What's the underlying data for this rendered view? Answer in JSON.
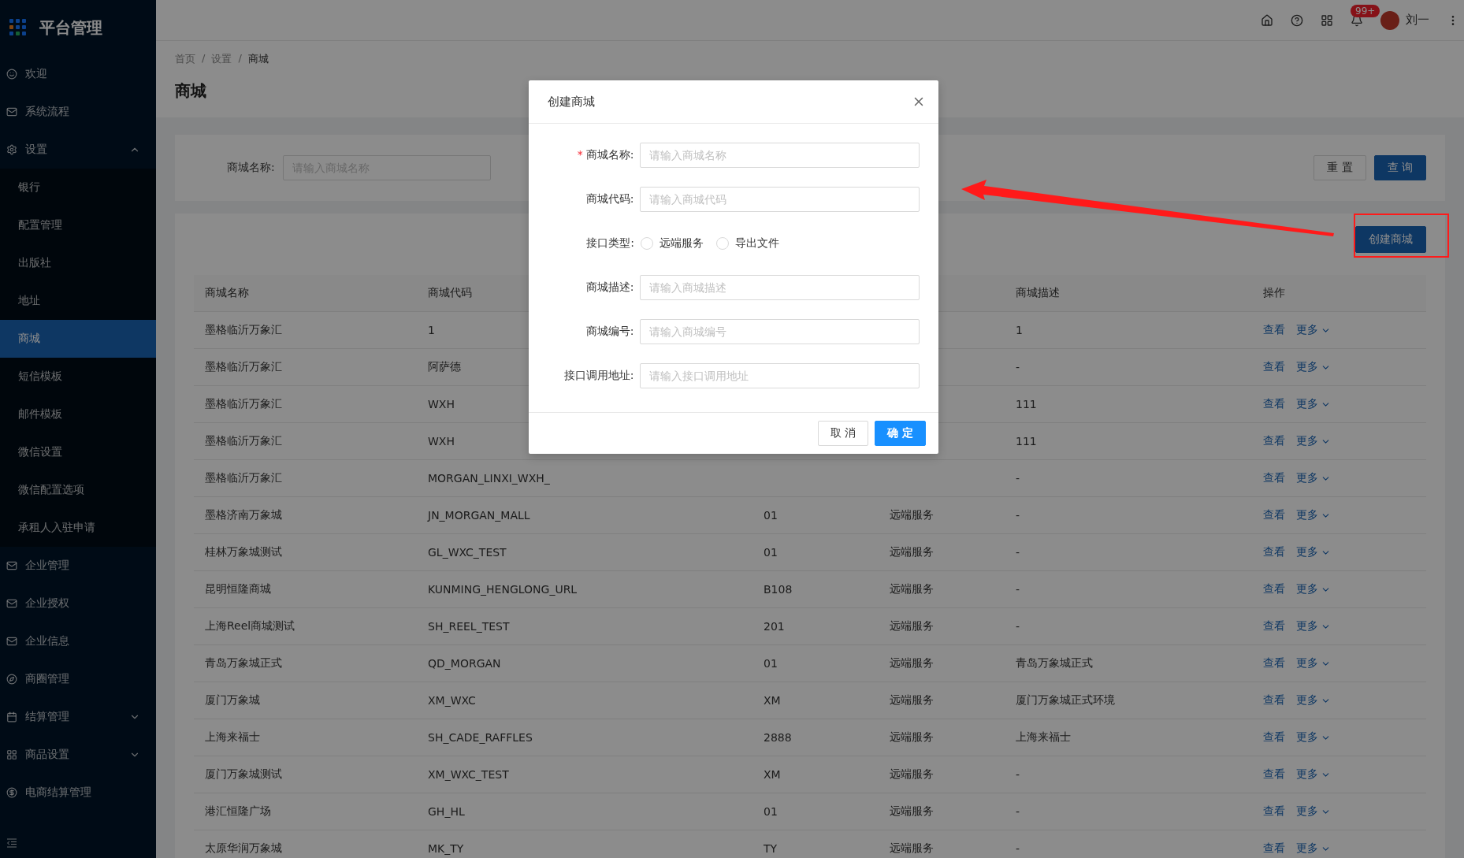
{
  "sidebar": {
    "logo": "平台管理",
    "items": [
      {
        "label": "欢迎",
        "selected": false
      },
      {
        "label": "系统流程",
        "selected": false
      },
      {
        "label": "设置",
        "selected": false,
        "expanded": true,
        "children": [
          {
            "label": "银行",
            "selected": false
          },
          {
            "label": "配置管理",
            "selected": false
          },
          {
            "label": "出版社",
            "selected": false
          },
          {
            "label": "地址",
            "selected": false
          },
          {
            "label": "商城",
            "selected": true
          },
          {
            "label": "短信模板",
            "selected": false
          },
          {
            "label": "邮件模板",
            "selected": false
          },
          {
            "label": "微信设置",
            "selected": false
          },
          {
            "label": "微信配置选项",
            "selected": false
          },
          {
            "label": "承租人入驻申请",
            "selected": false
          }
        ]
      },
      {
        "label": "企业管理",
        "selected": false
      },
      {
        "label": "企业授权",
        "selected": false
      },
      {
        "label": "企业信息",
        "selected": false
      },
      {
        "label": "商圈管理",
        "selected": false
      },
      {
        "label": "结算管理",
        "selected": false,
        "expanded": false
      },
      {
        "label": "商品设置",
        "selected": false,
        "expanded": false
      },
      {
        "label": "电商结算管理",
        "selected": false
      }
    ]
  },
  "header": {
    "badge": "99+",
    "user": "刘一"
  },
  "breadcrumb": {
    "separator": "/",
    "items": [
      "首页",
      "设置",
      "商城"
    ]
  },
  "page_title": "商城",
  "search": {
    "label": "商城名称:",
    "placeholder": "请输入商城名称",
    "buttons": [
      "重 置",
      "查 询"
    ]
  },
  "create_button": "创建商城",
  "table": {
    "columns": [
      "商城名称",
      "商城代码",
      null,
      null,
      "商城描述",
      "操作"
    ],
    "rows": [
      {
        "cells": [
          "墨格临沂万象汇",
          "1",
          null,
          null,
          "1"
        ],
        "actions": [
          "查看",
          "更多"
        ]
      },
      {
        "cells": [
          "墨格临沂万象汇",
          "阿萨德",
          null,
          null,
          "-"
        ],
        "actions": [
          "查看",
          "更多"
        ]
      },
      {
        "cells": [
          "墨格临沂万象汇",
          "WXH",
          null,
          null,
          "111"
        ],
        "actions": [
          "查看",
          "更多"
        ]
      },
      {
        "cells": [
          "墨格临沂万象汇",
          "WXH",
          null,
          null,
          "111"
        ],
        "actions": [
          "查看",
          "更多"
        ]
      },
      {
        "cells": [
          "墨格临沂万象汇",
          "MORGAN_LINXI_WXH_",
          null,
          null,
          "-"
        ],
        "actions": [
          "查看",
          "更多"
        ]
      },
      {
        "cells": [
          "墨格济南万象城",
          "JN_MORGAN_MALL",
          "01",
          "远端服务",
          "-"
        ],
        "actions": [
          "查看",
          "更多"
        ]
      },
      {
        "cells": [
          "桂林万象城测试",
          "GL_WXC_TEST",
          "01",
          "远端服务",
          "-"
        ],
        "actions": [
          "查看",
          "更多"
        ]
      },
      {
        "cells": [
          "昆明恒隆商城",
          "KUNMING_HENGLONG_URL",
          "B108",
          "远端服务",
          "-"
        ],
        "actions": [
          "查看",
          "更多"
        ]
      },
      {
        "cells": [
          "上海Reel商城测试",
          "SH_REEL_TEST",
          "201",
          "远端服务",
          "-"
        ],
        "actions": [
          "查看",
          "更多"
        ]
      },
      {
        "cells": [
          "青岛万象城正式",
          "QD_MORGAN",
          "01",
          "远端服务",
          "青岛万象城正式"
        ],
        "actions": [
          "查看",
          "更多"
        ]
      },
      {
        "cells": [
          "厦门万象城",
          "XM_WXC",
          "XM",
          "远端服务",
          "厦门万象城正式环境"
        ],
        "actions": [
          "查看",
          "更多"
        ]
      },
      {
        "cells": [
          "上海来福士",
          "SH_CADE_RAFFLES",
          "2888",
          "远端服务",
          "上海来福士"
        ],
        "actions": [
          "查看",
          "更多"
        ]
      },
      {
        "cells": [
          "厦门万象城测试",
          "XM_WXC_TEST",
          "XM",
          "远端服务",
          "-"
        ],
        "actions": [
          "查看",
          "更多"
        ]
      },
      {
        "cells": [
          "港汇恒隆广场",
          "GH_HL",
          "01",
          "远端服务",
          "-"
        ],
        "actions": [
          "查看",
          "更多"
        ]
      },
      {
        "cells": [
          "太原华润万象城",
          "MK_TY",
          "TY",
          "远端服务",
          "-"
        ],
        "actions": [
          "查看",
          "更多"
        ]
      }
    ]
  },
  "modal": {
    "title": "创建商城",
    "fields": [
      {
        "kind": "input",
        "label": "商城名称:",
        "required_mark": "*",
        "placeholder": "请输入商城名称"
      },
      {
        "kind": "input",
        "label": "商城代码:",
        "placeholder": "请输入商城代码"
      },
      {
        "kind": "radio",
        "label": "接口类型:",
        "options": [
          {
            "label": "远端服务",
            "selected": false
          },
          {
            "label": "导出文件",
            "selected": false
          }
        ]
      },
      {
        "kind": "input",
        "label": "商城描述:",
        "placeholder": "请输入商城描述"
      },
      {
        "kind": "input",
        "label": "商城编号:",
        "placeholder": "请输入商城编号"
      },
      {
        "kind": "input",
        "label": "接口调用地址:",
        "placeholder": "请输入接口调用地址"
      }
    ],
    "buttons": [
      "取 消",
      "确 定"
    ]
  }
}
